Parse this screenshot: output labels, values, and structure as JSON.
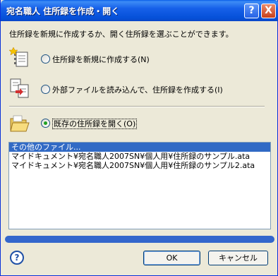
{
  "window": {
    "title": "宛名職人 住所録を作成・開く",
    "help_button": "?",
    "close_button": "X"
  },
  "description": "住所録を新規に作成するか、開く住所録を選ぶことができます。",
  "options": [
    {
      "label": "住所録を新規に作成する(N)",
      "icon": "new-address-book-icon",
      "selected": false
    },
    {
      "label": "外部ファイルを読み込んで、住所録を作成する(I)",
      "icon": "import-file-icon",
      "selected": false
    },
    {
      "label": "既存の住所録を開く(O)",
      "icon": "open-folder-icon",
      "selected": true
    }
  ],
  "file_list": {
    "items": [
      "その他のファイル...",
      "マイドキュメント¥宛名職人2007SN¥個人用¥住所録のサンプル.ata",
      "マイドキュメント¥宛名職人2007SN¥個人用¥住所録のサンプル2.ata"
    ],
    "selected_index": 0
  },
  "footer": {
    "help_icon": "?",
    "ok_label": "OK",
    "cancel_label": "キャンセル"
  },
  "colors": {
    "title_bar": "#0a5fe8",
    "selection": "#316ac5",
    "progress": "#3366cc",
    "radio_dot": "#21a121"
  }
}
